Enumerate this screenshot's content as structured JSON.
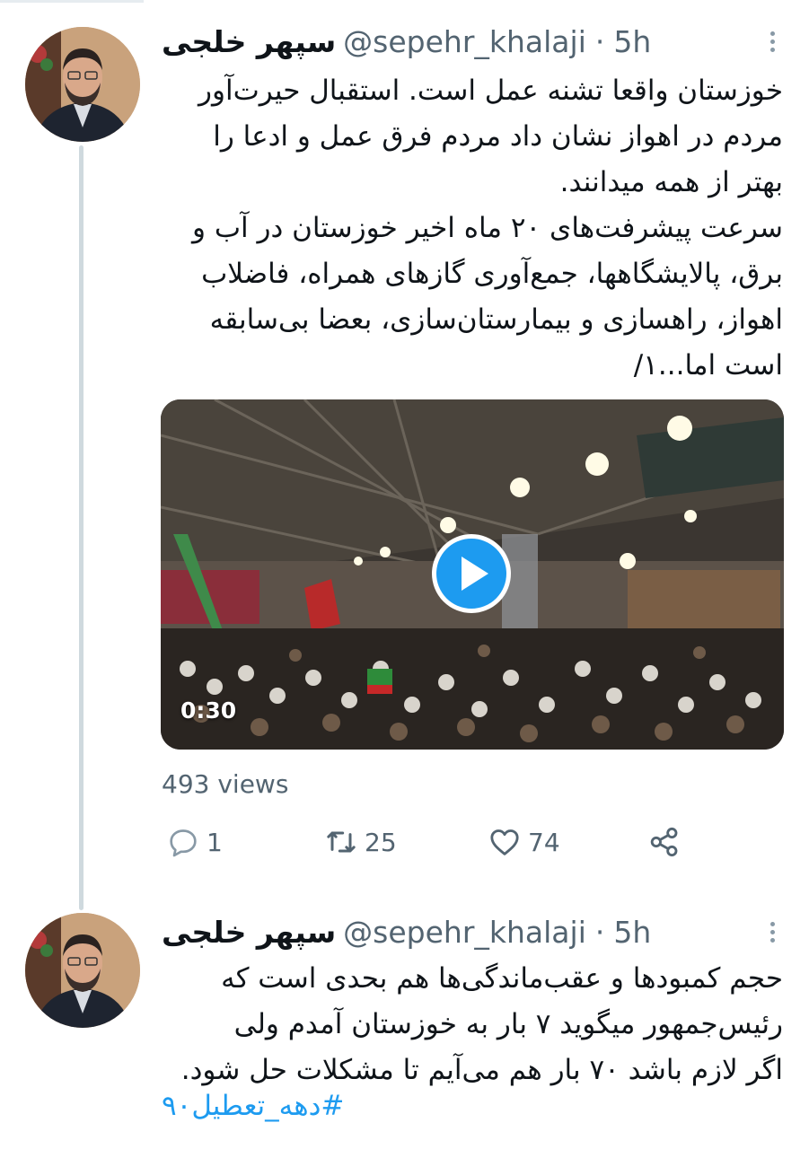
{
  "tweets": [
    {
      "author_name": "سپهر خلجی",
      "handle": "@sepehr_khalaji",
      "separator": "·",
      "time": "5h",
      "text": "خوزستان واقعا تشنه عمل است. استقبال حیرت‌آور\nمردم در اهواز نشان داد مردم فرق عمل و ادعا را\nبهتر از همه میدانند.\nسرعت پیشرفت‌های ۲۰ ماه اخیر خوزستان در آب و\nبرق، پالایشگاهها، جمع‌آوری گازهای همراه، فاضلاب\nاهواز، راهسازی و بیمارستان‌سازی، بعضا بی‌سابقه\nاست اما...۱/",
      "video_duration": "0:30",
      "views": "493 views",
      "actions": {
        "reply": "1",
        "retweet": "25",
        "like": "74"
      }
    },
    {
      "author_name": "سپهر خلجی",
      "handle": "@sepehr_khalaji",
      "separator": "·",
      "time": "5h",
      "text": "حجم کمبودها و عقب‌ماندگی‌ها هم بحدی است که\nرئیس‌جمهور میگوید ۷ بار به خوزستان آمدم ولی\nاگر لازم باشد ۷۰ بار هم می‌آیم تا مشکلات حل شود.",
      "hashtag": "#دهه_تعطیل۹۰"
    }
  ],
  "colors": {
    "accent": "#1d9bf0",
    "muted": "#536471",
    "text": "#0f1419"
  },
  "icons": [
    "more-icon",
    "play-icon",
    "reply-icon",
    "retweet-icon",
    "like-icon",
    "share-icon"
  ]
}
